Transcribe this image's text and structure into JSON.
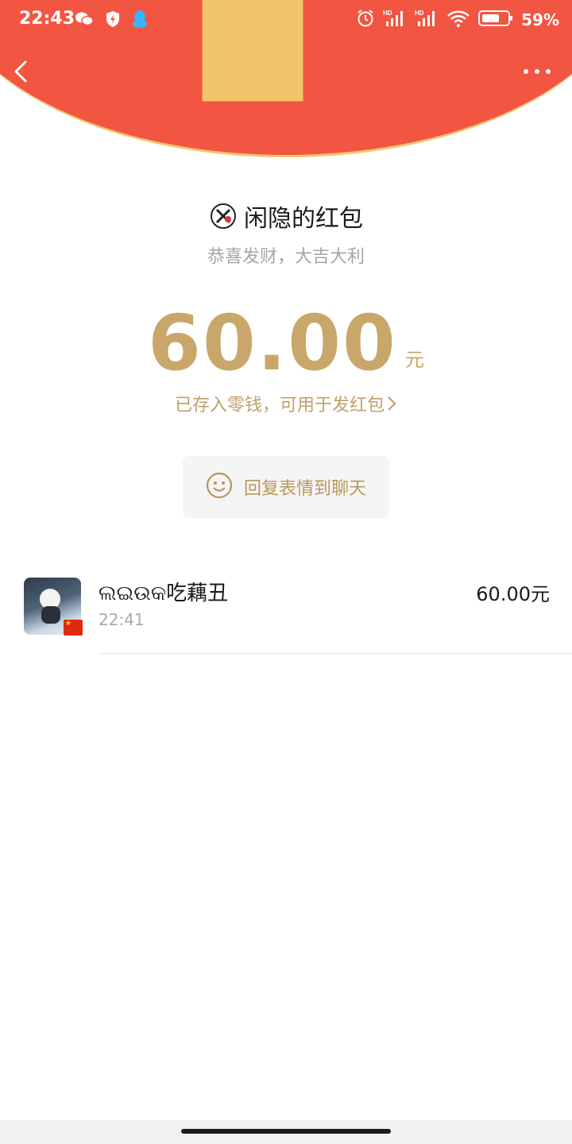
{
  "status_bar": {
    "time": "22:43",
    "battery_percent": "59%",
    "icons_left": [
      "wechat-icon",
      "shield-icon",
      "qq-icon"
    ],
    "icons_right": [
      "alarm-icon",
      "signal-hd-icon",
      "signal-hd-icon",
      "wifi-icon",
      "battery-icon"
    ]
  },
  "nav": {
    "back_icon": "chevron-left-icon",
    "more_icon": "more-dots-icon"
  },
  "red_packet": {
    "sender_title": "闲隐的红包",
    "greeting": "恭喜发财，大吉大利",
    "amount": "60.00",
    "unit": "元",
    "saved_link": "已存入零钱，可用于发红包",
    "reply_label": "回复表情到聊天"
  },
  "receivers": [
    {
      "name": "ଲଇଉକ吃藕丑",
      "time": "22:41",
      "amount": "60.00元"
    }
  ],
  "colors": {
    "header_red": "#f25542",
    "gold": "#c9a76a",
    "header_border": "#f2c46b"
  }
}
